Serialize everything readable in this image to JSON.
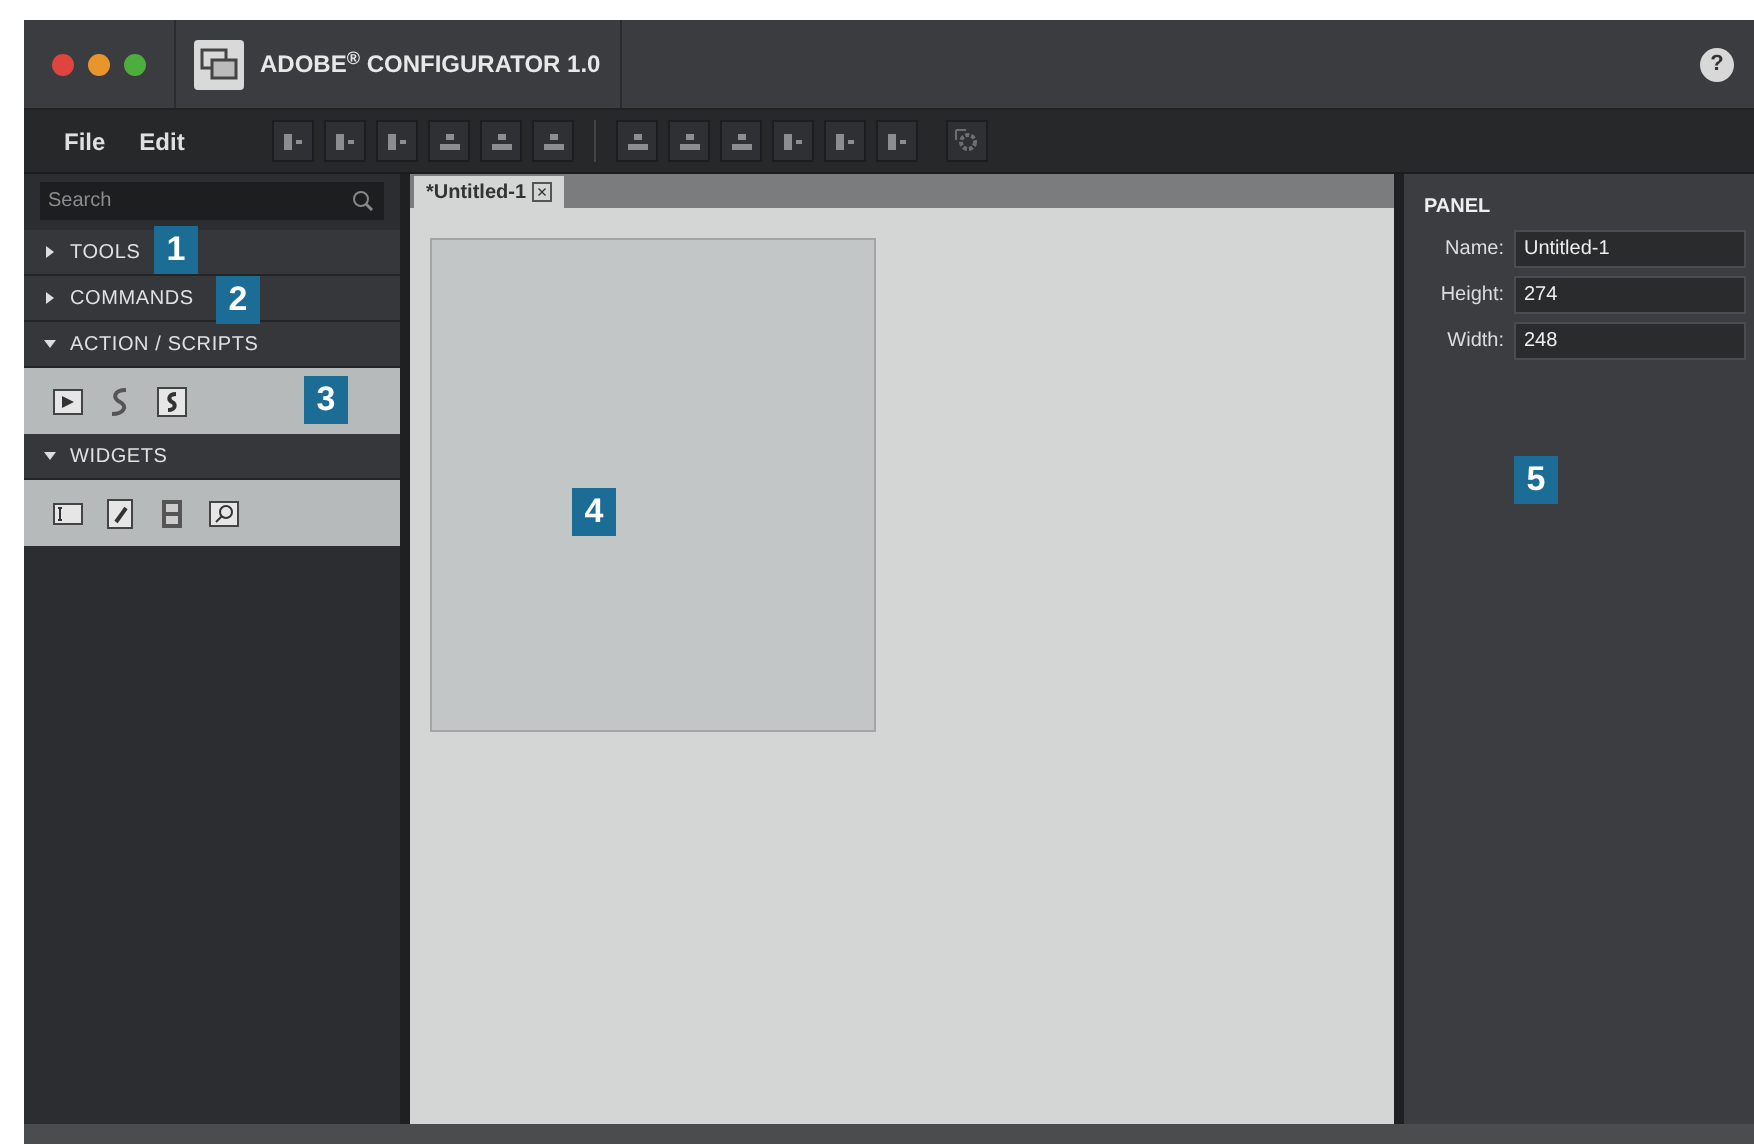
{
  "window": {
    "title": "ADOBE$^{®}$ CONFIGURATOR 1.0"
  },
  "menu": [
    "File",
    "Edit"
  ],
  "help": "?",
  "toolbar": {
    "groups": [
      [
        {
          "kind": "left"
        },
        {
          "kind": "center"
        },
        {
          "kind": "right"
        },
        {
          "kind": "top"
        },
        {
          "kind": "middle"
        },
        {
          "kind": "bottom"
        }
      ],
      [
        {
          "kind": "top"
        },
        {
          "kind": "middle"
        },
        {
          "kind": "bottom"
        },
        {
          "kind": "h1"
        },
        {
          "kind": "h2"
        },
        {
          "kind": "h3"
        }
      ]
    ]
  },
  "sidebar": {
    "search": {
      "placeholder": "Search"
    },
    "sections": [
      {
        "label": "TOOLS",
        "expanded": false
      },
      {
        "label": "COMMANDS",
        "expanded": false
      },
      {
        "label": "ACTION / SCRIPTS",
        "expanded": true,
        "items": [
          {
            "kind": "play"
          },
          {
            "kind": "script"
          },
          {
            "kind": "script-page"
          }
        ]
      },
      {
        "label": "WIDGETS",
        "expanded": true,
        "items": [
          {
            "kind": "text-field"
          },
          {
            "kind": "edit-page"
          },
          {
            "kind": "film"
          },
          {
            "kind": "search"
          }
        ]
      }
    ]
  },
  "document_tab": {
    "label": "*Untitled-1",
    "close": "×"
  },
  "panel": {
    "heading": "PANEL",
    "fields": [
      {
        "label": "Name:",
        "value": "Untitled-1"
      },
      {
        "label": "Height:",
        "value": "274"
      },
      {
        "label": "Width:",
        "value": "248"
      }
    ]
  },
  "callouts": [
    "1",
    "2",
    "3",
    "4",
    "5"
  ]
}
